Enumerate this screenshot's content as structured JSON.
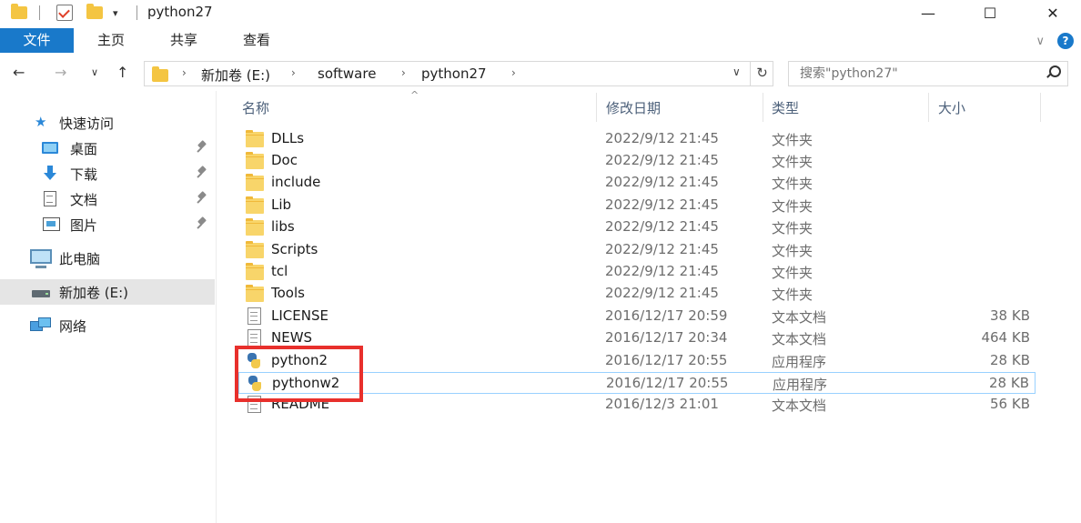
{
  "window": {
    "title": "python27",
    "minimize_glyph": "—",
    "maximize_glyph": "☐",
    "close_glyph": "✕"
  },
  "ribbon": {
    "tabs": [
      {
        "label": "文件",
        "active": true
      },
      {
        "label": "主页",
        "active": false
      },
      {
        "label": "共享",
        "active": false
      },
      {
        "label": "查看",
        "active": false
      }
    ],
    "expand_glyph": "∨",
    "help_glyph": "?"
  },
  "navigation": {
    "back_glyph": "←",
    "forward_glyph": "→",
    "recent_glyph": "∨",
    "up_glyph": "↑",
    "breadcrumb": [
      "新加卷 (E:)",
      "software",
      "python27"
    ],
    "crumb_separator": "›",
    "dropdown_glyph": "∨",
    "refresh_glyph": "↻",
    "search_placeholder": "搜索\"python27\""
  },
  "sidebar": {
    "quick_access": "快速访问",
    "items": [
      {
        "label": "桌面",
        "icon": "desktop-icon",
        "pinned": true
      },
      {
        "label": "下载",
        "icon": "download-icon",
        "pinned": true
      },
      {
        "label": "文档",
        "icon": "documents-icon",
        "pinned": true
      },
      {
        "label": "图片",
        "icon": "pictures-icon",
        "pinned": true
      }
    ],
    "this_pc": "此电脑",
    "drive": "新加卷 (E:)",
    "network": "网络"
  },
  "columns": {
    "name": "名称",
    "date": "修改日期",
    "type": "类型",
    "size": "大小",
    "sort_glyph": "^"
  },
  "files": [
    {
      "name": "DLLs",
      "date": "2022/9/12 21:45",
      "type": "文件夹",
      "size": "",
      "icon": "folder-icon"
    },
    {
      "name": "Doc",
      "date": "2022/9/12 21:45",
      "type": "文件夹",
      "size": "",
      "icon": "folder-icon"
    },
    {
      "name": "include",
      "date": "2022/9/12 21:45",
      "type": "文件夹",
      "size": "",
      "icon": "folder-icon"
    },
    {
      "name": "Lib",
      "date": "2022/9/12 21:45",
      "type": "文件夹",
      "size": "",
      "icon": "folder-icon"
    },
    {
      "name": "libs",
      "date": "2022/9/12 21:45",
      "type": "文件夹",
      "size": "",
      "icon": "folder-icon"
    },
    {
      "name": "Scripts",
      "date": "2022/9/12 21:45",
      "type": "文件夹",
      "size": "",
      "icon": "folder-icon"
    },
    {
      "name": "tcl",
      "date": "2022/9/12 21:45",
      "type": "文件夹",
      "size": "",
      "icon": "folder-icon"
    },
    {
      "name": "Tools",
      "date": "2022/9/12 21:45",
      "type": "文件夹",
      "size": "",
      "icon": "folder-icon"
    },
    {
      "name": "LICENSE",
      "date": "2016/12/17 20:59",
      "type": "文本文档",
      "size": "38 KB",
      "icon": "text-file-icon"
    },
    {
      "name": "NEWS",
      "date": "2016/12/17 20:34",
      "type": "文本文档",
      "size": "464 KB",
      "icon": "text-file-icon"
    },
    {
      "name": "python2",
      "date": "2016/12/17 20:55",
      "type": "应用程序",
      "size": "28 KB",
      "icon": "python-icon"
    },
    {
      "name": "pythonw2",
      "date": "2016/12/17 20:55",
      "type": "应用程序",
      "size": "28 KB",
      "icon": "python-icon"
    },
    {
      "name": "README",
      "date": "2016/12/3 21:01",
      "type": "文本文档",
      "size": "56 KB",
      "icon": "text-file-icon"
    }
  ],
  "colors": {
    "accent": "#1979ca",
    "highlight": "#e8302c",
    "selection": "#e5e5e5"
  }
}
